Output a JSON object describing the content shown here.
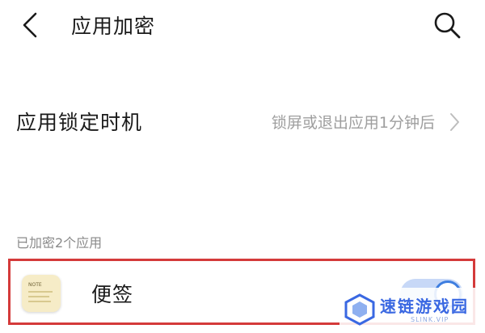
{
  "header": {
    "title": "应用加密",
    "back_icon": "chevron-left-icon",
    "search_icon": "search-icon"
  },
  "lock_timing": {
    "label": "应用锁定时机",
    "value": "锁屏或退出应用1分钟后"
  },
  "encrypted_section": {
    "label": "已加密2个应用"
  },
  "apps": [
    {
      "name": "便签",
      "icon": "note-app-icon",
      "icon_label": "NOTE",
      "encrypted": true
    }
  ],
  "watermark": {
    "title": "速链游戏园",
    "subtitle": "SLINK.VIP"
  },
  "colors": {
    "accent": "#3e7ee0",
    "toggle_track": "#c7d8f7",
    "highlight_border": "#d43a3a",
    "secondary_text": "#9e9e9e"
  }
}
